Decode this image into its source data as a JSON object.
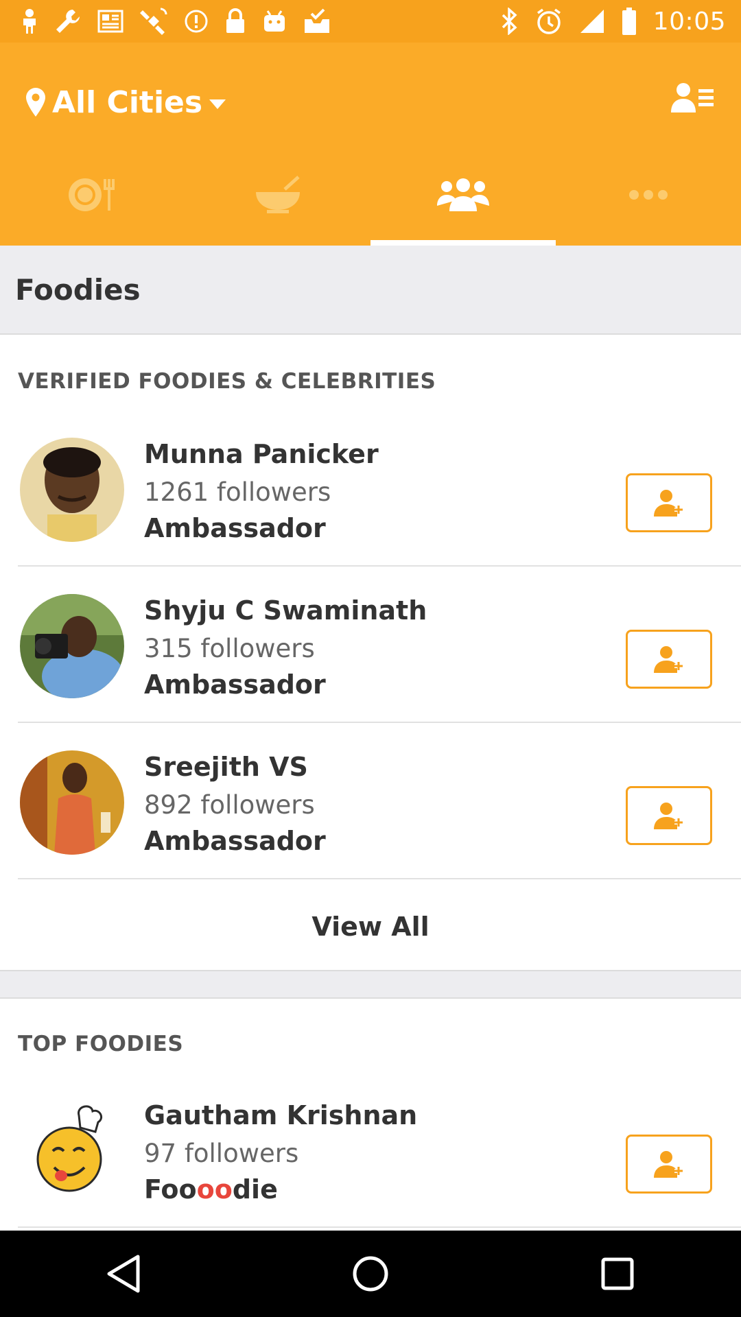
{
  "status_bar": {
    "time": "10:05",
    "left_icons": [
      "person-icon",
      "wrench-icon",
      "news-icon",
      "satellite-icon",
      "alert-icon",
      "lock-icon",
      "android-icon",
      "inbox-check-icon"
    ],
    "right_icons": [
      "bluetooth-icon",
      "alarm-icon",
      "signal-icon",
      "battery-icon"
    ]
  },
  "header": {
    "city_label": "All Cities",
    "tabs": [
      {
        "icon": "plate-fork-icon",
        "active": false
      },
      {
        "icon": "bowl-icon",
        "active": false
      },
      {
        "icon": "group-icon",
        "active": true
      },
      {
        "icon": "more-dots-icon",
        "active": false
      }
    ]
  },
  "section": {
    "title": "Foodies"
  },
  "verified": {
    "title": "VERIFIED FOODIES & CELEBRITIES",
    "users": [
      {
        "name": "Munna Panicker",
        "followers": "1261 followers",
        "rank": "Ambassador"
      },
      {
        "name": "Shyju C Swaminath",
        "followers": "315 followers",
        "rank": "Ambassador"
      },
      {
        "name": "Sreejith VS",
        "followers": "892 followers",
        "rank": "Ambassador"
      }
    ],
    "view_all": "View All"
  },
  "top": {
    "title": "TOP FOODIES",
    "users": [
      {
        "name": "Gautham Krishnan",
        "followers": "97 followers",
        "rank_prefix": "Foo",
        "rank_highlight": "oo",
        "rank_suffix": "die"
      }
    ]
  },
  "colors": {
    "brand": "#fbab28",
    "status_bar": "#f7a21d",
    "accent_text": "#e8463c"
  }
}
